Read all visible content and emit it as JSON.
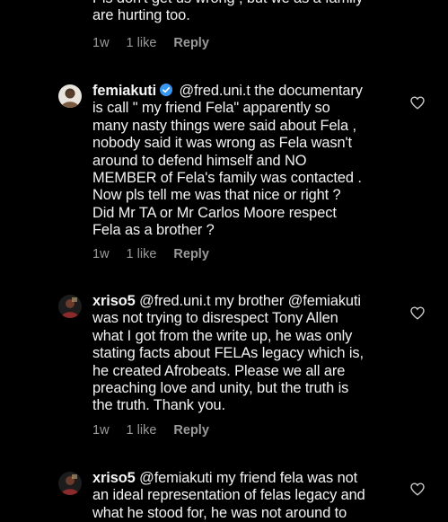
{
  "comments": [
    {
      "text": "Pls don't get us wrong , but we as a family\nare hurting too.",
      "time": "1w",
      "likes": "1 like",
      "reply": "Reply"
    },
    {
      "username": "femiakuti",
      "verified": true,
      "text": " @fred.uni.t the documentary\nis call \" my friend Fela\" apparently so\nmany nasty things were said about Fela ,\nnobody said it was wrong as Fela wasn't\naround to defend himself and NO\nMEMBER of Fela's family was contacted .\nNow pls tell me was that nice or right ?\nDid Mr TA or Mr Carlos Moore respect\nFela as a brother ?",
      "time": "1w",
      "likes": "1 like",
      "reply": "Reply",
      "like_icon": "heart-outline-icon"
    },
    {
      "username": "xriso5",
      "text": " @fred.uni.t my brother @femiakuti\nwas not trying to disrespect Tony Allen\nwhat I got from the write up, he was only\nstating facts about FELAs legacy which is,\nhe created Afrobeats. Please we all are\npreaching love and unity, but the truth is\nthe truth. Thank you.",
      "time": "1w",
      "likes": "1 like",
      "reply": "Reply",
      "like_icon": "heart-outline-icon"
    },
    {
      "username": "xriso5",
      "text": " @femiakuti my friend fela was not\nan ideal representation of felas legacy and\nwhat he stood for, he was not around to",
      "like_icon": "heart-outline-icon"
    }
  ],
  "colors": {
    "background": "#000000",
    "text": "#f2f2f2",
    "meta": "#9a9a9a",
    "verified": "#3897f0"
  }
}
